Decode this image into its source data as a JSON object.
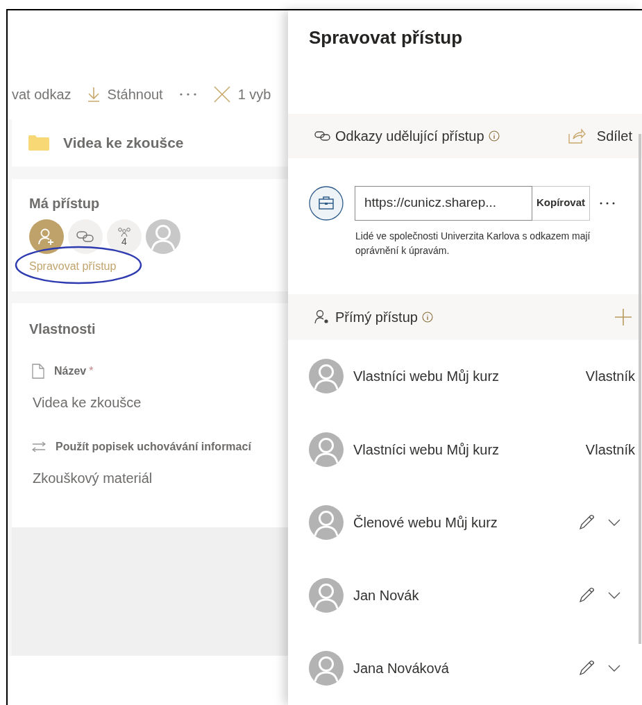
{
  "left_panel": {
    "toolbar": {
      "cut_action": "vat odkaz",
      "download": "Stáhnout",
      "selection": "1 vyb"
    },
    "item_card": {
      "name": "Videa ke zkoušce"
    },
    "access": {
      "title": "Má přístup",
      "avatars": [
        {
          "kind": "add"
        },
        {
          "kind": "link"
        },
        {
          "kind": "group",
          "count": "4"
        },
        {
          "kind": "person"
        }
      ],
      "manage_link": "Spravovat přístup",
      "annotated": true
    },
    "properties": {
      "title": "Vlastnosti",
      "fields": [
        {
          "kind": "name",
          "label": "Název",
          "marker": "*",
          "value": "Videa ke zkoušce"
        },
        {
          "kind": "retention",
          "label": "Použít popisek uchovávání informací",
          "value": "Zkouškový materiál"
        }
      ]
    }
  },
  "panel": {
    "title": "Spravovat přístup",
    "links_section": {
      "title": "Odkazy udělující přístup",
      "share": "Sdílet"
    },
    "link": {
      "url": "https://cunicz.sharep...",
      "copy": "Kopírovat",
      "description": "Lidé ve společnosti Univerzita Karlova s odkazem mají oprávnění k úpravám."
    },
    "direct_section": {
      "title": "Přímý přístup"
    },
    "members": [
      {
        "name": "Vlastníci webu Můj kurz",
        "kind": "role",
        "role": "Vlastník"
      },
      {
        "name": "Vlastníci webu Můj kurz",
        "kind": "role",
        "role": "Vlastník"
      },
      {
        "name": "Členové webu Můj kurz",
        "kind": "edit"
      },
      {
        "name": "Jan Novák",
        "kind": "edit"
      },
      {
        "name": "Jana Nováková",
        "kind": "edit"
      }
    ]
  }
}
